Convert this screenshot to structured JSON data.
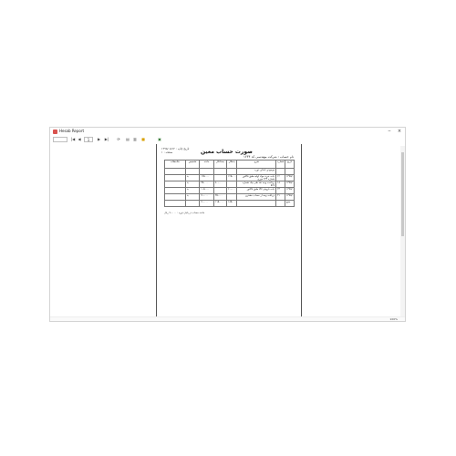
{
  "window": {
    "title": "Hesab Report",
    "minimize": "‒",
    "close": "×"
  },
  "toolbar": {
    "first": "|◀",
    "prev": "◀",
    "page_value": "1",
    "next": "▶",
    "last": "▶|",
    "colors": {
      "save_icon": "#f0c040",
      "export_icon": "#3a7d3a"
    }
  },
  "document": {
    "title": "صورت حساب معین",
    "date_label": "تاریخ چاپ : ۱۳۹۵/۰۸/۱۲",
    "page_label": "صفحه : ۱",
    "account_label": "نام حساب : شرکت مهندسی کد ۱۲۳۴",
    "columns": [
      "تاریخ",
      "شماره",
      "شرح",
      "بدهکار",
      "بستانکار",
      "مانده",
      "تشخیص",
      "ملاحظات"
    ],
    "rows": [
      [
        "",
        "",
        "موجودی ابتدای دوره",
        "",
        "",
        "",
        "",
        ""
      ],
      [
        "۱۳۹۵/۰۱/۱۵",
        "۱۲",
        "بابت خرید مواد اولیه طبق فاکتور شماره ۲۳۴ مورخ",
        "۱۲۵،۰۰۰",
        "",
        "۱۲۵،۰۰۰",
        "بد",
        ""
      ],
      [
        "۱۳۹۵/۰۲/۱۰",
        "۱۸",
        "پرداخت وجه نقد طی چک شماره ۵۶۷",
        "",
        "۸۰،۰۰۰",
        "۴۵،۰۰۰",
        "بد",
        ""
      ],
      [
        "۱۳۹۵/۰۳/۰۵",
        "۲۴",
        "بابت فروش کالا طبق فاکتور",
        "۶۰،۰۰۰",
        "",
        "۱۰۵،۰۰۰",
        "بد",
        ""
      ],
      [
        "۱۳۹۵/۰۴/۲۰",
        "۳۱",
        "دریافت وجه از حساب مشتری",
        "",
        "۳۵،۰۰۰",
        "۷۰،۰۰۰",
        "بد",
        ""
      ]
    ],
    "totals": [
      "جمع",
      "",
      "",
      "۱۸۵،۰۰۰",
      "۱۱۵،۰۰۰",
      "۷۰،۰۰۰",
      "",
      ""
    ],
    "footnote": "مانده حساب در پایان دوره : ۷۰،۰۰۰ ریال"
  },
  "status": {
    "zoom": "100%"
  }
}
